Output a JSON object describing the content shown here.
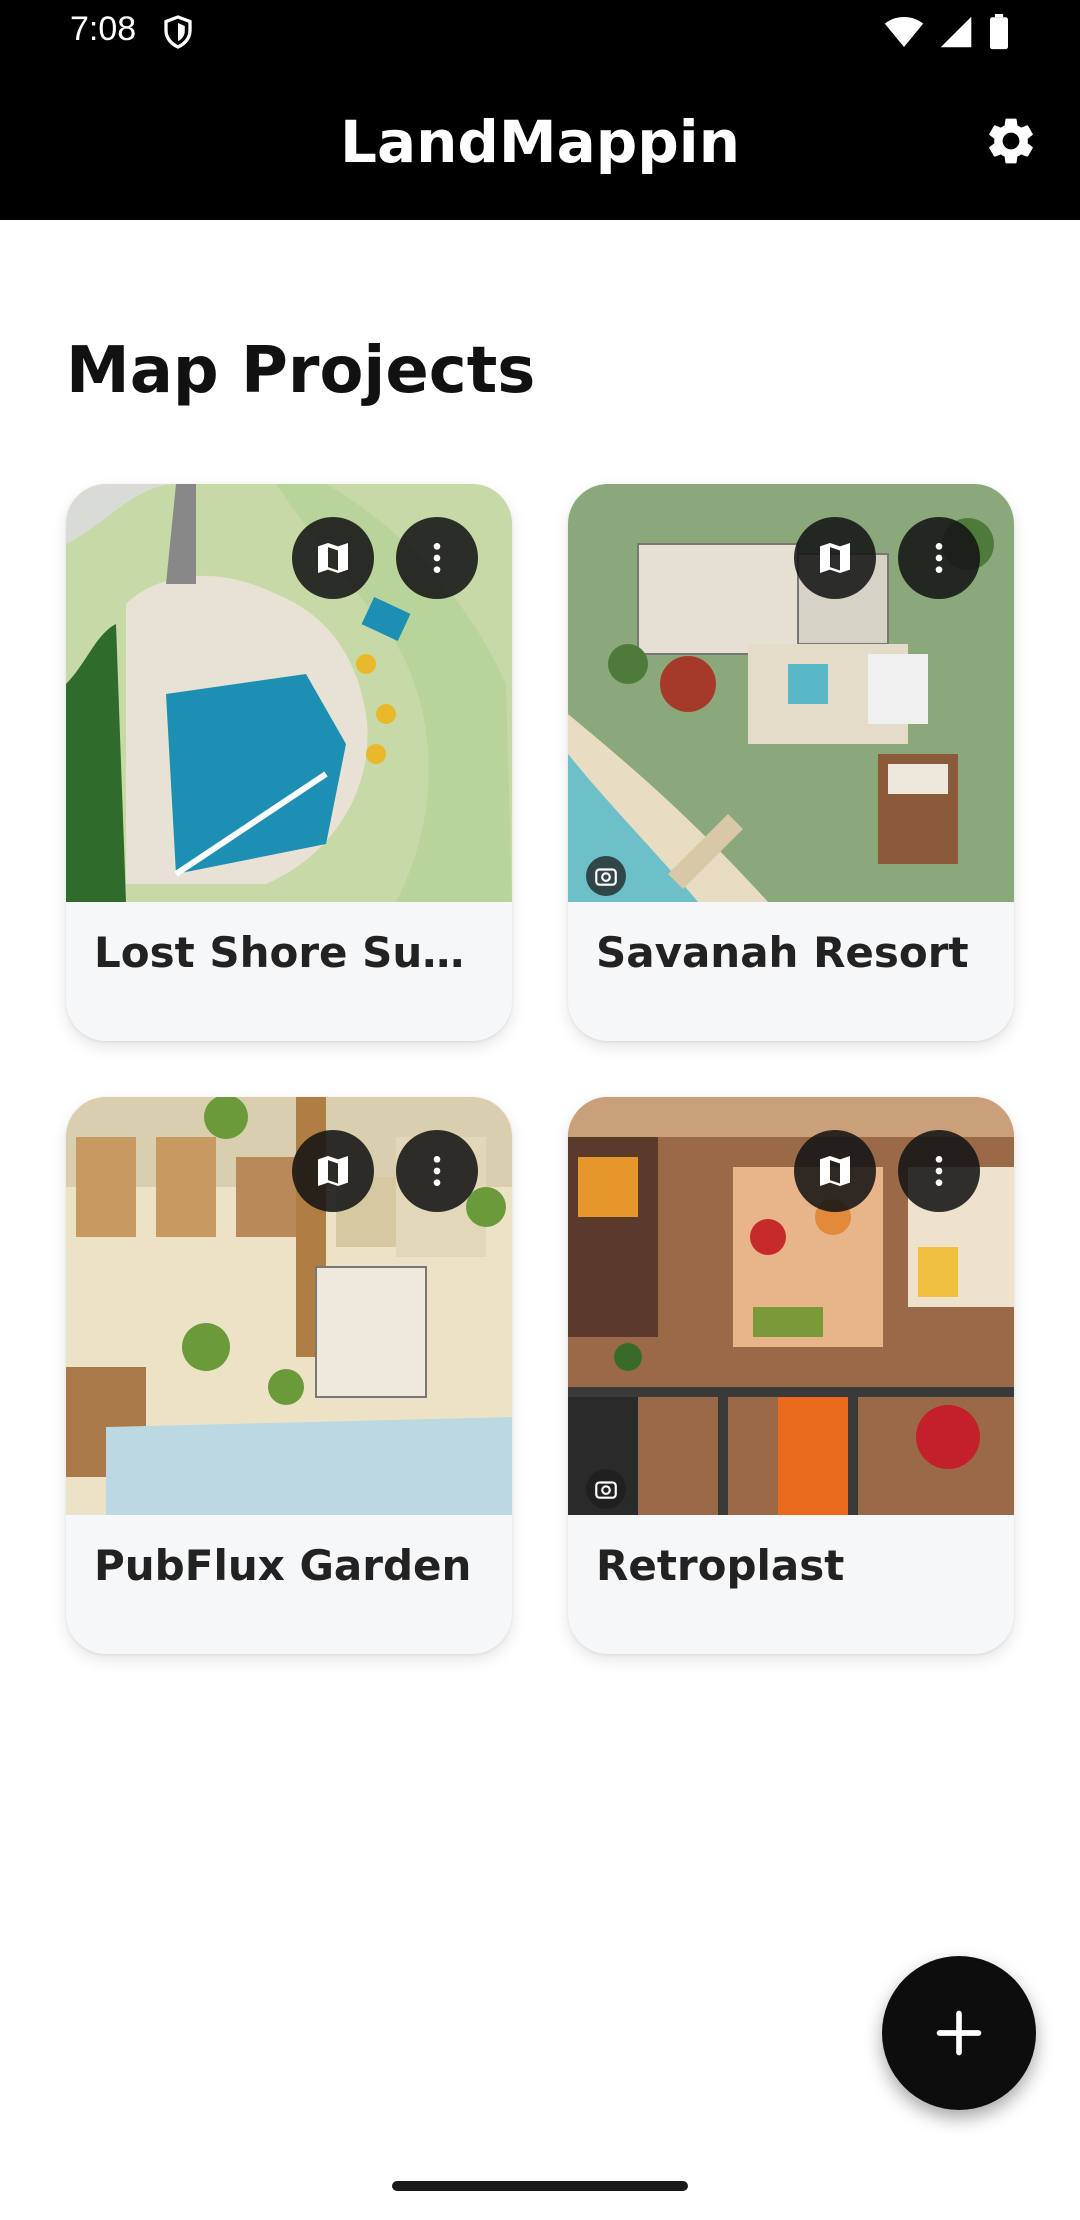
{
  "status_bar": {
    "time": "7:08"
  },
  "app_bar": {
    "title": "LandMappin",
    "settings_icon": "gear-icon"
  },
  "section": {
    "title": "Map Projects"
  },
  "projects": [
    {
      "name": "Lost Shore Surf Resort",
      "display_name": "Lost Shore Surf ...",
      "thumbnail": "surf-park-site-plan",
      "has_camera_badge": false
    },
    {
      "name": "Savanah Resort",
      "display_name": "Savanah Resort",
      "thumbnail": "resort-villa-site-plan",
      "has_camera_badge": true
    },
    {
      "name": "PubFlux Garden",
      "display_name": "PubFlux Garden",
      "thumbnail": "garden-terrace-plan",
      "has_camera_badge": false
    },
    {
      "name": "Retroplast",
      "display_name": "Retroplast",
      "thumbnail": "retro-interior-floor-plan",
      "has_camera_badge": true
    }
  ],
  "fab": {
    "icon": "plus-icon"
  },
  "colors": {
    "bar": "#000000",
    "card": "#f6f7f9",
    "fab": "#0d0d0d"
  }
}
